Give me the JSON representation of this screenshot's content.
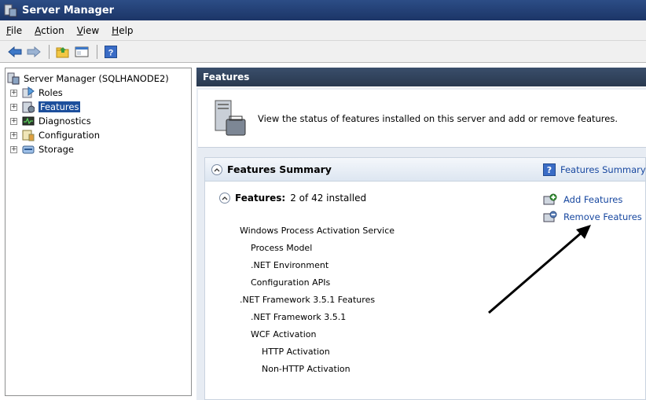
{
  "window": {
    "title": "Server Manager"
  },
  "menu": [
    {
      "accel": "F",
      "rest": "ile"
    },
    {
      "accel": "A",
      "rest": "ction"
    },
    {
      "accel": "V",
      "rest": "iew"
    },
    {
      "accel": "H",
      "rest": "elp"
    }
  ],
  "tree": {
    "root": "Server Manager (SQLHANODE2)",
    "items": [
      {
        "label": "Roles",
        "icon": "roles-icon"
      },
      {
        "label": "Features",
        "icon": "features-icon",
        "selected": true
      },
      {
        "label": "Diagnostics",
        "icon": "diagnostics-icon"
      },
      {
        "label": "Configuration",
        "icon": "configuration-icon"
      },
      {
        "label": "Storage",
        "icon": "storage-icon"
      }
    ]
  },
  "content": {
    "header": "Features",
    "intro": "View the status of features installed on this server and add or remove features.",
    "summary_title": "Features Summary",
    "help_link": "Features Summary",
    "features_label": "Features:",
    "features_count": "2 of 42 installed",
    "actions": [
      "Add Features",
      "Remove Features"
    ],
    "list": [
      {
        "text": "Windows Process Activation Service",
        "level": 1
      },
      {
        "text": "Process Model",
        "level": 2
      },
      {
        "text": ".NET Environment",
        "level": 2
      },
      {
        "text": "Configuration APIs",
        "level": 2
      },
      {
        "text": ".NET Framework 3.5.1 Features",
        "level": 1
      },
      {
        "text": ".NET Framework 3.5.1",
        "level": 2
      },
      {
        "text": "WCF Activation",
        "level": 2
      },
      {
        "text": "HTTP Activation",
        "level": 3
      },
      {
        "text": "Non-HTTP Activation",
        "level": 3
      }
    ]
  },
  "colors": {
    "title_bar": "#1c3567",
    "selected": "#1d4f9c",
    "link": "#1848a0",
    "content_header": "#29394f"
  }
}
